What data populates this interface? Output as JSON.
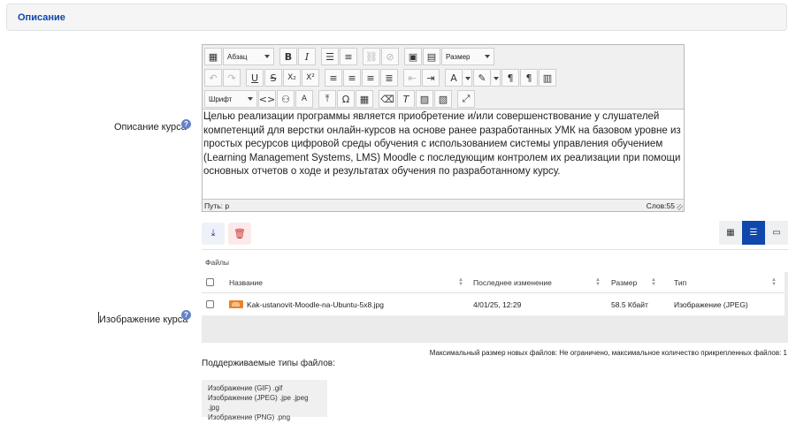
{
  "section": {
    "title": "Описание"
  },
  "course_description": {
    "label": "Описание курса",
    "help": "?",
    "toolbar": {
      "paragraph_select": "Абзац",
      "size_select": "Размер",
      "font_select": "Шрифт",
      "icons": {
        "row1": [
          "html-source-icon",
          "bold-icon",
          "italic-icon",
          "bullet-list-icon",
          "numbered-list-icon",
          "link-icon",
          "unlink-icon",
          "image-icon",
          "media-icon"
        ],
        "row2": [
          "undo-icon",
          "redo-icon",
          "underline-icon",
          "strikethrough-icon",
          "subscript-icon",
          "superscript-icon",
          "align-left-icon",
          "align-center-icon",
          "align-right-icon",
          "justify-icon",
          "outdent-icon",
          "indent-icon",
          "text-color-icon",
          "highlight-icon",
          "ltr-icon",
          "rtl-icon",
          "media-embed-icon"
        ],
        "row3": [
          "code-icon",
          "spellcheck-icon",
          "charmap-icon",
          "special-char-icon",
          "table-icon",
          "clean-format-icon",
          "clear-format-icon",
          "paste-text-icon",
          "paste-word-icon",
          "fullscreen-icon"
        ]
      }
    },
    "text": "Целью реализации программы является приобретение и/или совершенствование у слушателей компетенций для верстки онлайн-курсов на основе ранее разработанных УМК на базовом уровне из простых ресурсов цифровой среды обучения с использованием системы управления обучением (Learning Management Systems, LMS) Moodle с последующим контролем их реализации при помощи основных отчетов о ходе и результатах обучения по разработанному курсу.",
    "status_path": "Путь: p",
    "word_count": "Слов:55"
  },
  "course_image": {
    "label": "Изображение курса",
    "help": "?",
    "path_label": "Файлы",
    "columns": [
      "Название",
      "Последнее изменение",
      "Размер",
      "Тип"
    ],
    "files": [
      {
        "name": "Kak-ustanovit-Moodle-na-Ubuntu-5x8.jpg",
        "modified": "4/01/25, 12:29",
        "size": "58.5 Кбайт",
        "type": "Изображение (JPEG)"
      }
    ],
    "limit_text": "Максимальный размер новых файлов: Не ограничено, максимальное количество прикрепленных файлов: 1",
    "types_title": "Поддерживаемые типы файлов:",
    "types": [
      "Изображение (GIF) .gif",
      "Изображение (JPEG) .jpe .jpeg .jpg",
      "Изображение (PNG) .png"
    ]
  },
  "colors": {
    "accent": "#0f47ad",
    "delete": "#cc3333",
    "help": "#6582c9"
  }
}
